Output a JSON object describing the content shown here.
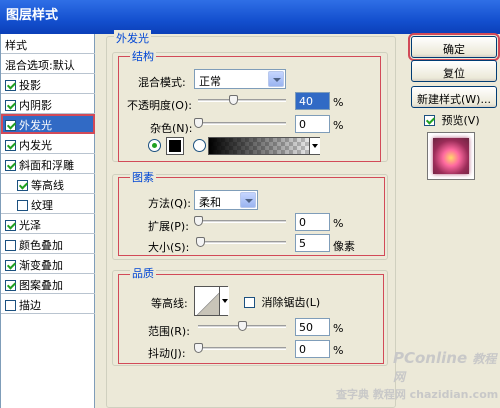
{
  "window": {
    "title": "图层样式"
  },
  "sidebar": {
    "header": "样式",
    "items": [
      {
        "label": "混合选项:默认",
        "checkbox": null,
        "selected": false,
        "indent": false
      },
      {
        "label": "投影",
        "checkbox": true,
        "selected": false,
        "indent": false
      },
      {
        "label": "内阴影",
        "checkbox": true,
        "selected": false,
        "indent": false
      },
      {
        "label": "外发光",
        "checkbox": true,
        "selected": true,
        "indent": false
      },
      {
        "label": "内发光",
        "checkbox": true,
        "selected": false,
        "indent": false
      },
      {
        "label": "斜面和浮雕",
        "checkbox": true,
        "selected": false,
        "indent": false
      },
      {
        "label": "等高线",
        "checkbox": true,
        "selected": false,
        "indent": true
      },
      {
        "label": "纹理",
        "checkbox": false,
        "selected": false,
        "indent": true
      },
      {
        "label": "光泽",
        "checkbox": true,
        "selected": false,
        "indent": false
      },
      {
        "label": "颜色叠加",
        "checkbox": false,
        "selected": false,
        "indent": false
      },
      {
        "label": "渐变叠加",
        "checkbox": true,
        "selected": false,
        "indent": false
      },
      {
        "label": "图案叠加",
        "checkbox": true,
        "selected": false,
        "indent": false
      },
      {
        "label": "描边",
        "checkbox": false,
        "selected": false,
        "indent": false
      }
    ]
  },
  "panel": {
    "title": "外发光",
    "structure": {
      "legend": "结构",
      "blend_mode_label": "混合模式:",
      "blend_mode_value": "正常",
      "opacity_label": "不透明度(O):",
      "opacity_value": "40",
      "opacity_fraction": 0.4,
      "opacity_unit": "%",
      "noise_label": "杂色(N):",
      "noise_value": "0",
      "noise_fraction": 0,
      "noise_unit": "%",
      "swatch_color": "#000000"
    },
    "elements": {
      "legend": "图素",
      "method_label": "方法(Q):",
      "method_value": "柔和",
      "spread_label": "扩展(P):",
      "spread_value": "0",
      "spread_fraction": 0,
      "spread_unit": "%",
      "size_label": "大小(S):",
      "size_value": "5",
      "size_fraction": 0.02,
      "size_unit": "像素"
    },
    "quality": {
      "legend": "品质",
      "contour_label": "等高线:",
      "antialias_label": "消除锯齿(L)",
      "antialias_checked": false,
      "range_label": "范围(R):",
      "range_value": "50",
      "range_fraction": 0.5,
      "range_unit": "%",
      "jitter_label": "抖动(J):",
      "jitter_value": "0",
      "jitter_fraction": 0,
      "jitter_unit": "%"
    }
  },
  "buttons": {
    "ok": "确定",
    "reset": "复位",
    "new_style": "新建样式(W)...",
    "preview_label": "预览(V)",
    "preview_checked": true
  },
  "watermark": {
    "brand": "PConline",
    "brand_sub": "教程网",
    "site": "查字典 教程网 chazidian.com"
  },
  "colors": {
    "accent": "#316ac5",
    "highlight_border": "#d24a58",
    "legend_text": "#0046d5"
  }
}
